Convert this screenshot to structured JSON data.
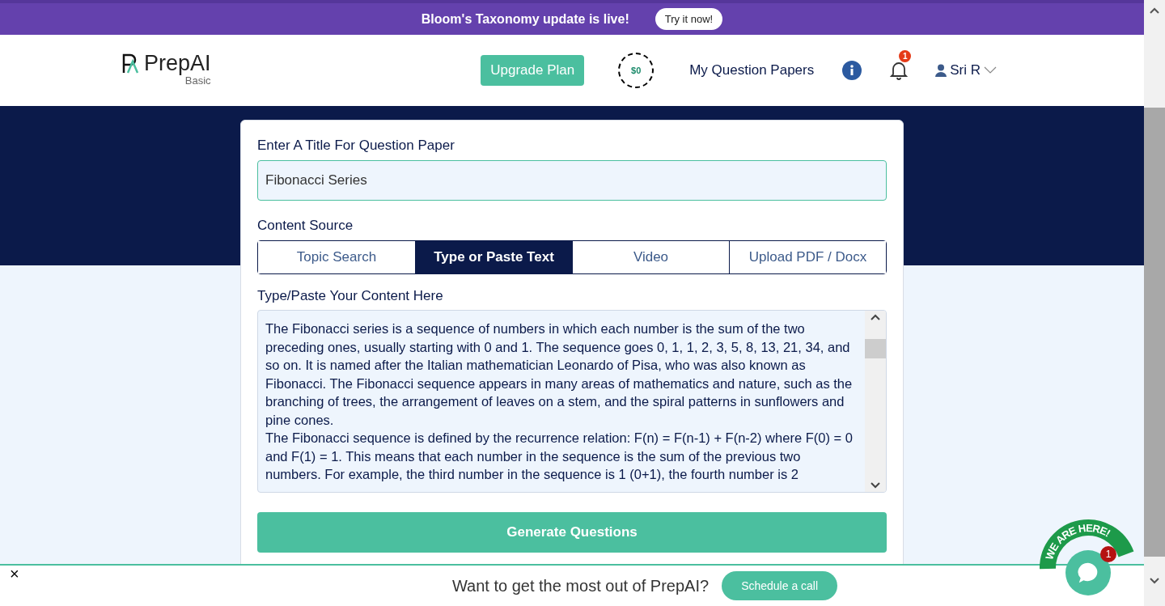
{
  "announcement": {
    "text": "Bloom's Taxonomy update is live!",
    "button": "Try it now!"
  },
  "header": {
    "logo": "PrepAI",
    "plan": "Basic",
    "upgrade_button": "Upgrade Plan",
    "credits": "$0",
    "nav_link": "My Question Papers",
    "notification_count": "1",
    "user": "Sri R"
  },
  "form": {
    "title_label": "Enter A Title For Question Paper",
    "title_value": "Fibonacci Series",
    "source_label": "Content Source",
    "tabs": [
      {
        "label": "Topic Search",
        "selected": false
      },
      {
        "label": "Type or Paste Text",
        "selected": true
      },
      {
        "label": "Video",
        "selected": false
      },
      {
        "label": "Upload PDF / Docx",
        "selected": false
      }
    ],
    "content_label": "Type/Paste Your Content Here",
    "content_paragraphs": [
      "The Fibonacci series is a sequence of numbers in which each number is the sum of the two preceding ones, usually starting with 0 and 1. The sequence goes 0, 1, 1, 2, 3, 5, 8, 13, 21, 34, and so on. It is named after the Italian mathematician Leonardo of Pisa, who was also known as Fibonacci. The Fibonacci sequence appears in many areas of mathematics and nature, such as the branching of trees, the arrangement of leaves on a stem, and the spiral patterns in sunflowers and pine cones.",
      "The Fibonacci sequence is defined by the recurrence relation: F(n) = F(n-1) + F(n-2) where F(0) = 0 and F(1) = 1. This means that each number in the sequence is the sum of the previous two numbers. For example, the third number in the sequence is 1 (0+1), the fourth number is 2"
    ],
    "generate_button": "Generate Questions"
  },
  "chat_widget": {
    "banner": "WE ARE HERE!",
    "unread": "1"
  },
  "footer_bar": {
    "text": "Want to get the most out of PrepAI?",
    "button": "Schedule a call",
    "close": "×"
  }
}
